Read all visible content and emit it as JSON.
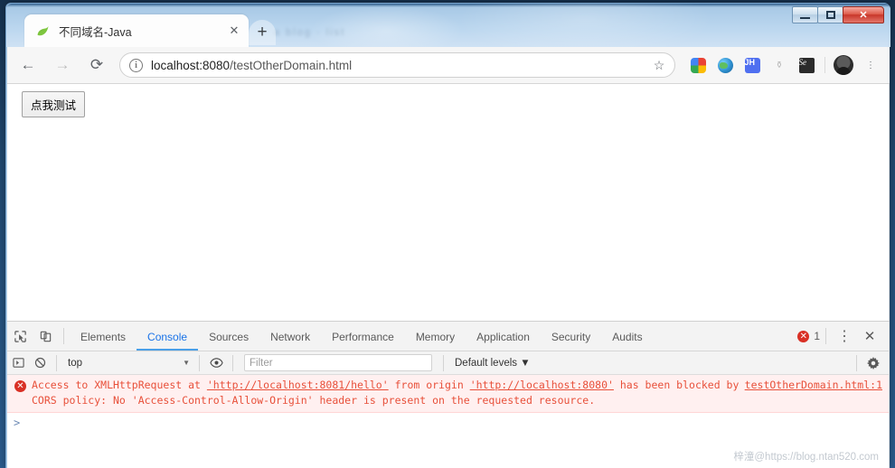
{
  "window": {
    "controls": {
      "minimize": "minimize-button",
      "maximize": "maximize-button",
      "close": "✕"
    },
    "glass_ghost_text": "a  blog  ·  list"
  },
  "tab": {
    "title": "不同域名-Java",
    "favicon": "spring-leaf-icon",
    "close_label": "✕",
    "newtab_label": "+"
  },
  "toolbar": {
    "back": "←",
    "forward": "→",
    "reload": "⟳",
    "info_icon": "i",
    "url_scheme_host": "localhost:8080",
    "url_path": "/testOtherDomain.html",
    "url_full": "localhost:8080/testOtherDomain.html",
    "star": "☆",
    "extensions": [
      {
        "name": "google-photos-extension",
        "label": ""
      },
      {
        "name": "globe-extension",
        "label": ""
      },
      {
        "name": "jh-extension",
        "label": "JH"
      },
      {
        "name": "tree-extension",
        "label": "⚱"
      },
      {
        "name": "selenium-extension",
        "label": "Se"
      }
    ],
    "avatar": "profile-avatar",
    "menu": "⋮"
  },
  "page": {
    "button_label": "点我测试"
  },
  "devtools": {
    "inspect_icon": "inspect-element-icon",
    "device_icon": "device-toolbar-icon",
    "tabs": [
      {
        "label": "Elements",
        "active": false
      },
      {
        "label": "Console",
        "active": true
      },
      {
        "label": "Sources",
        "active": false
      },
      {
        "label": "Network",
        "active": false
      },
      {
        "label": "Performance",
        "active": false
      },
      {
        "label": "Memory",
        "active": false
      },
      {
        "label": "Application",
        "active": false
      },
      {
        "label": "Security",
        "active": false
      },
      {
        "label": "Audits",
        "active": false
      }
    ],
    "error_count": "1",
    "more_menu": "⋮",
    "close": "✕",
    "console_toolbar": {
      "sidebar_toggle": "console-sidebar-toggle-icon",
      "clear": "⃠",
      "context": "top",
      "context_caret": "▼",
      "eye": "live-expression-icon",
      "filter_placeholder": "Filter",
      "levels": "Default levels ▼",
      "settings": "settings-gear-icon"
    },
    "console": {
      "error": {
        "icon": "✕",
        "part1": "Access to XMLHttpRequest at ",
        "url1": "'http://localhost:8081/hello'",
        "part2": " from origin ",
        "url2": "'http://localhost:8080'",
        "part3": " has been blocked by CORS policy: No 'Access-Control-Allow-Origin' header is present on the requested resource.",
        "source": "testOtherDomain.html:1"
      },
      "prompt": ">"
    }
  },
  "watermark": "梓潼@https://blog.ntan520.com",
  "colors": {
    "error_text": "#e8503a",
    "error_bg": "#fff0f0",
    "active_tab": "#1a73e8",
    "error_badge": "#d93025",
    "close_button": "#c8362a"
  }
}
